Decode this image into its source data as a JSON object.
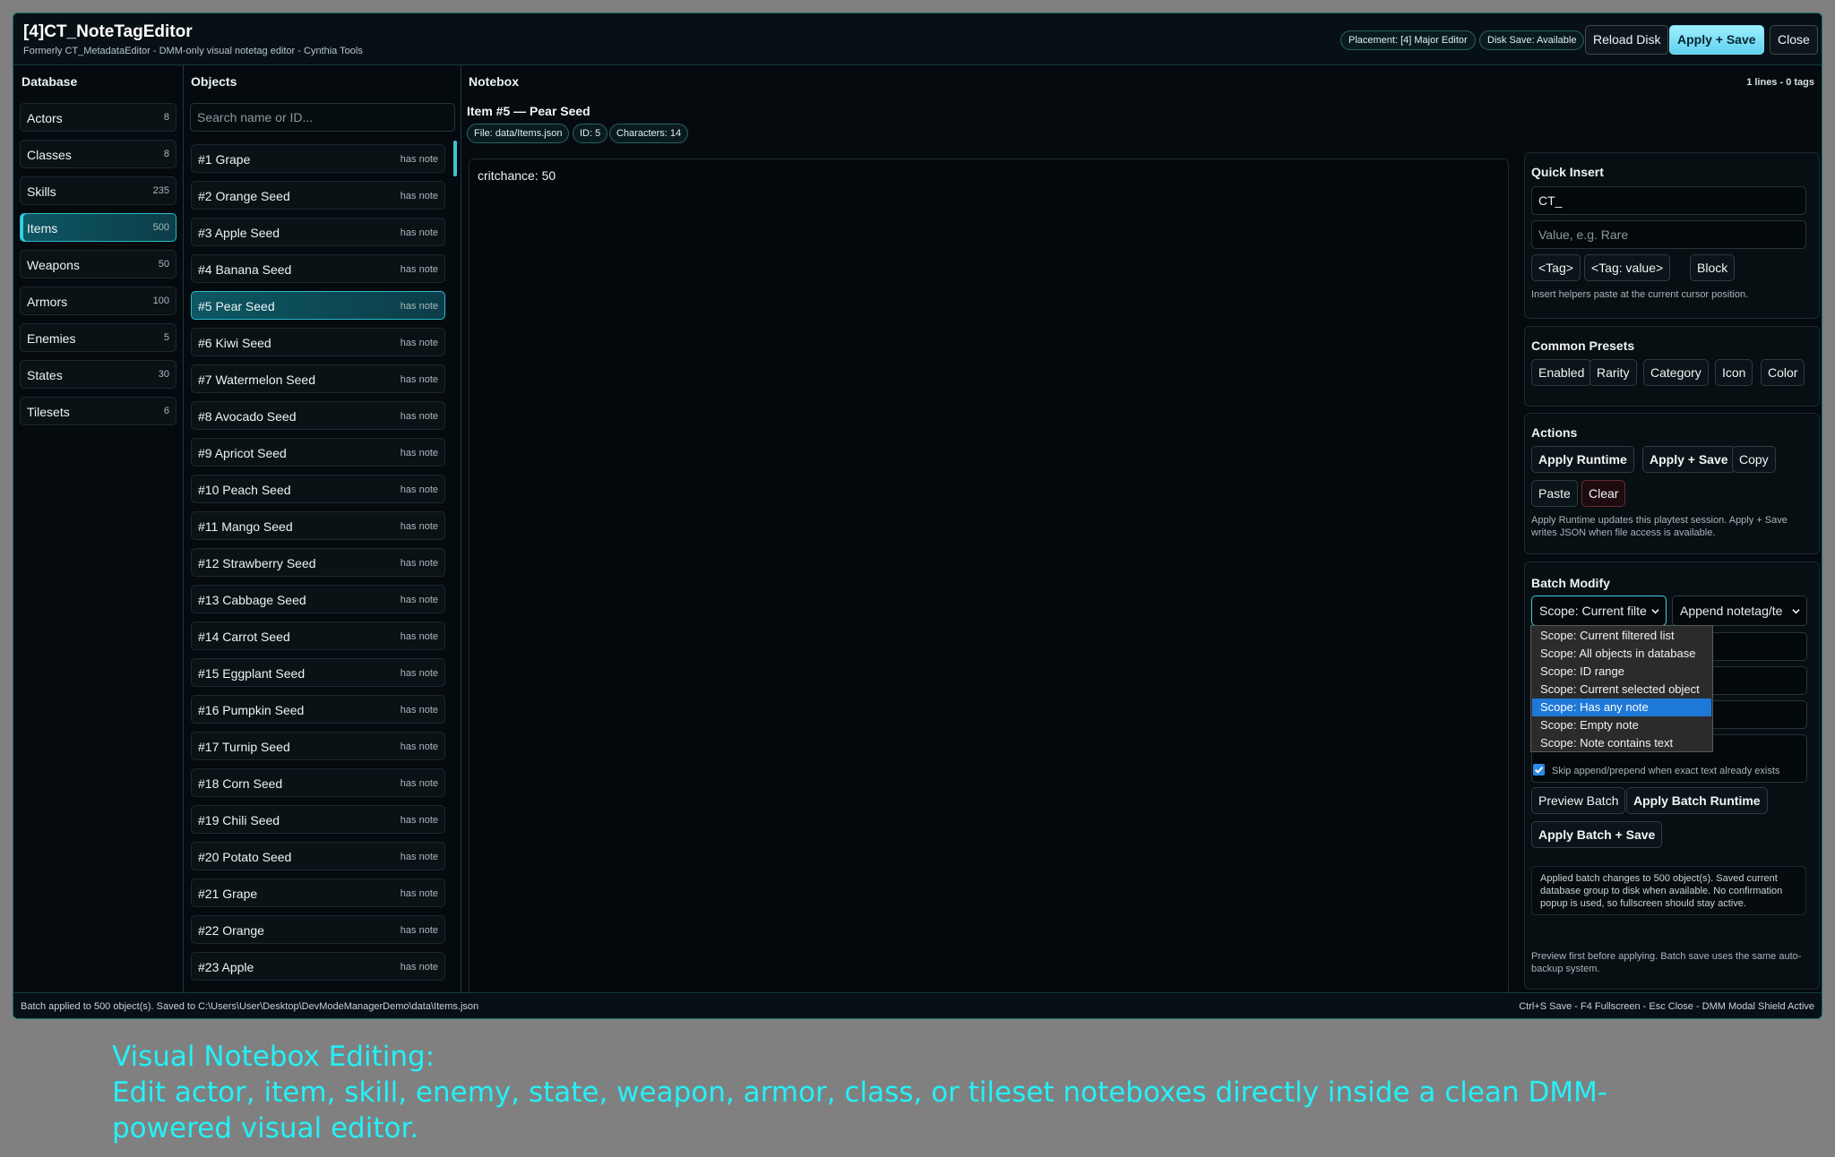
{
  "header": {
    "title": "[4]CT_NoteTagEditor",
    "subtitle": "Formerly CT_MetadataEditor - DMM-only visual notetag editor - Cynthia Tools",
    "placement": "Placement: [4] Major Editor",
    "disk_save": "Disk Save: Available",
    "reload": "Reload Disk",
    "apply_save": "Apply + Save",
    "close": "Close"
  },
  "database": {
    "heading": "Database",
    "items": [
      {
        "label": "Actors",
        "count": "8"
      },
      {
        "label": "Classes",
        "count": "8"
      },
      {
        "label": "Skills",
        "count": "235"
      },
      {
        "label": "Items",
        "count": "500"
      },
      {
        "label": "Weapons",
        "count": "50"
      },
      {
        "label": "Armors",
        "count": "100"
      },
      {
        "label": "Enemies",
        "count": "5"
      },
      {
        "label": "States",
        "count": "30"
      },
      {
        "label": "Tilesets",
        "count": "6"
      }
    ],
    "active_index": 3
  },
  "objects": {
    "heading": "Objects",
    "search_placeholder": "Search name or ID...",
    "tag": "has note",
    "active_index": 4,
    "items": [
      "#1 Grape",
      "#2 Orange Seed",
      "#3 Apple Seed",
      "#4 Banana Seed",
      "#5 Pear Seed",
      "#6 Kiwi Seed",
      "#7 Watermelon Seed",
      "#8 Avocado Seed",
      "#9 Apricot Seed",
      "#10 Peach Seed",
      "#11 Mango Seed",
      "#12 Strawberry Seed",
      "#13 Cabbage Seed",
      "#14 Carrot Seed",
      "#15 Eggplant Seed",
      "#16 Pumpkin Seed",
      "#17 Turnip Seed",
      "#18 Corn Seed",
      "#19 Chili Seed",
      "#20 Potato Seed",
      "#21 Grape",
      "#22 Orange",
      "#23 Apple"
    ]
  },
  "notebox": {
    "heading": "Notebox",
    "meta": "1 lines - 0 tags",
    "item_title": "Item #5 — Pear Seed",
    "chips": [
      "File: data/Items.json",
      "ID: 5",
      "Characters: 14"
    ],
    "content": "critchance: 50"
  },
  "quick_insert": {
    "title": "Quick Insert",
    "tag_value": "CT_",
    "value_placeholder": "Value, e.g. Rare",
    "buttons": [
      "<Tag>",
      "<Tag: value>",
      "Block"
    ],
    "note": "Insert helpers paste at the current cursor position."
  },
  "presets": {
    "title": "Common Presets",
    "buttons": [
      "Enabled",
      "Rarity",
      "Category",
      "Icon",
      "Color"
    ]
  },
  "actions": {
    "title": "Actions",
    "apply_runtime": "Apply Runtime",
    "apply_save": "Apply + Save",
    "copy": "Copy",
    "paste": "Paste",
    "clear": "Clear",
    "note_line1": "Apply Runtime updates this playtest session. Apply + Save",
    "note_line2": "writes JSON when file access is available."
  },
  "batch": {
    "title": "Batch Modify",
    "scope_value": "Scope: Current filte",
    "mode_value": "Append notetag/te",
    "scope_options": [
      "Scope: Current filtered list",
      "Scope: All objects in database",
      "Scope: ID range",
      "Scope: Current selected object",
      "Scope: Has any note",
      "Scope: Empty note",
      "Scope: Note contains text"
    ],
    "highlighted_option": 4,
    "skip_checked": true,
    "skip_label": "Skip append/prepend when exact text already exists",
    "preview": "Preview Batch",
    "apply_runtime": "Apply Batch Runtime",
    "apply_save": "Apply Batch + Save",
    "result_line1": "Applied batch changes to 500 object(s). Saved current",
    "result_line2": "database group to disk when available. No confirmation",
    "result_line3": "popup is used, so fullscreen should stay active.",
    "note_line1": "Preview first before applying. Batch save uses the same auto-",
    "note_line2": "backup system."
  },
  "footer": {
    "left": "Batch applied to 500 object(s). Saved to C:\\Users\\User\\Desktop\\DevModeManagerDemo\\data\\Items.json",
    "right": "Ctrl+S Save - F4 Fullscreen - Esc Close - DMM Modal Shield Active"
  },
  "caption": {
    "line1": "Visual Notebox Editing:",
    "line2": "Edit actor, item, skill, enemy, state, weapon, armor, class, or tileset noteboxes directly inside a clean DMM-powered visual editor."
  },
  "colors": {
    "accent": "#37d2e2",
    "primary_button": "#61d0ee",
    "caption": "#25f0f7",
    "selection": "#1e78d8"
  },
  "icons": {
    "select_chevron": "chevron-down-icon",
    "checkbox": "checkmark-icon",
    "scrollbar": "scrollbar-thumb"
  }
}
